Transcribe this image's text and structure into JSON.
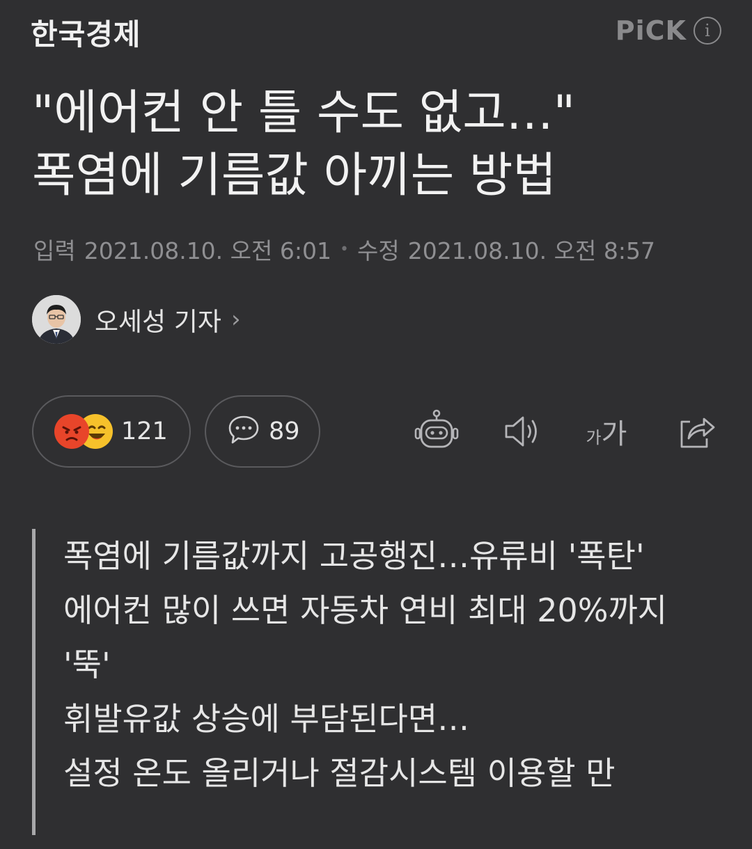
{
  "header": {
    "brand": "한국경제",
    "pick_label": "PiCK",
    "info_icon": "info-icon"
  },
  "article": {
    "headline_line1": "\"에어컨 안 틀 수도 없고…\"",
    "headline_line2": "폭염에 기름값 아끼는 방법",
    "input_label": "입력",
    "input_date": "2021.08.10. 오전 6:01",
    "separator": "•",
    "modified_label": "수정",
    "modified_date": "2021.08.10. 오전 8:57",
    "author": "오세성 기자",
    "author_chevron": "›"
  },
  "actions": {
    "reaction_count": "121",
    "comment_count": "89",
    "text_size_small": "가",
    "text_size_large": "가",
    "icons": [
      "robot-summary-icon",
      "speaker-icon",
      "text-size-icon",
      "share-icon"
    ]
  },
  "summary": {
    "lines": [
      "폭염에 기름값까지 고공행진…유류비 '폭탄'",
      "에어컨 많이 쓰면 자동차 연비 최대 20%까지 '뚝'",
      "휘발유값 상승에 부담된다면…",
      "설정 온도 올리거나 절감시스템 이용할 만"
    ]
  },
  "colors": {
    "background": "#2f2f31",
    "text": "#e8e8e8",
    "muted": "#8f8f92",
    "angry": "#e8452a",
    "laugh": "#f6c12b"
  }
}
